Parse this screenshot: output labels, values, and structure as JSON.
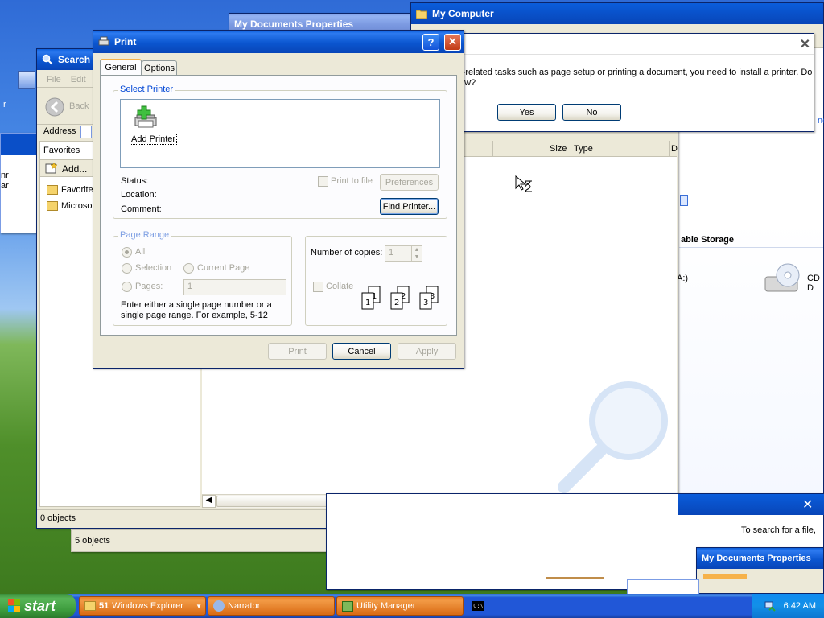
{
  "print_dialog": {
    "title": "Print",
    "tabs": [
      "General",
      "Options"
    ],
    "select_printer_legend": "Select Printer",
    "add_printer_label": "Add Printer",
    "status_label": "Status:",
    "location_label": "Location:",
    "comment_label": "Comment:",
    "print_to_file_label": "Print to file",
    "preferences_label": "Preferences",
    "find_printer_label": "Find Printer...",
    "page_range_legend": "Page Range",
    "all_label": "All",
    "selection_label": "Selection",
    "current_page_label": "Current Page",
    "pages_label": "Pages:",
    "pages_value": "1",
    "range_help": "Enter either a single page number or a single page range.  For example, 5-12",
    "copies_label": "Number of copies:",
    "copies_value": "1",
    "collate_label": "Collate",
    "print_button": "Print",
    "cancel_button": "Cancel",
    "apply_button": "Apply",
    "help_button": "?",
    "close_button": "✕"
  },
  "install_printer_dialog": {
    "message_line1": "r-related tasks such as page setup or printing a document, you need to install a printer. Do",
    "message_line2": "ow?",
    "yes_button": "Yes",
    "no_button": "No"
  },
  "search_window": {
    "title": "Search R",
    "menu_file": "File",
    "menu_edit": "Edit",
    "back_label": "Back",
    "address_label": "Address",
    "favorites_label": "Favorites",
    "add_label": "Add...",
    "favorites_items": [
      "Favorite",
      "Microsof"
    ],
    "status": "0 objects",
    "col_size": "Size",
    "col_type": "Type",
    "col_d": "D"
  },
  "my_documents_properties_title": "My Documents Properties",
  "my_computer": {
    "title": "My Computer",
    "removable_storage": "able Storage",
    "drive_a": "A:)",
    "cd_drive": "CD D"
  },
  "status_5_objects": "5 objects",
  "search_tip": "To search for a file,",
  "left_partial_text": [
    "nr",
    "ar"
  ],
  "right_partial_text": "nc",
  "taskbar": {
    "start_label": "start",
    "tasks": [
      "Windows Explorer",
      "Narrator",
      "Utility Manager"
    ],
    "explorer_group_count": "51",
    "cmd_label": "C:\\",
    "clock": "6:42 AM"
  },
  "colors": {
    "xp_title_blue": "#0a5ddb",
    "dialog_face": "#ece9d8",
    "groupbox_legend": "#0046d5",
    "disabled_text": "#a7a69c",
    "taskbar_blue": "#2157d7",
    "start_green": "#3b9a3b"
  }
}
